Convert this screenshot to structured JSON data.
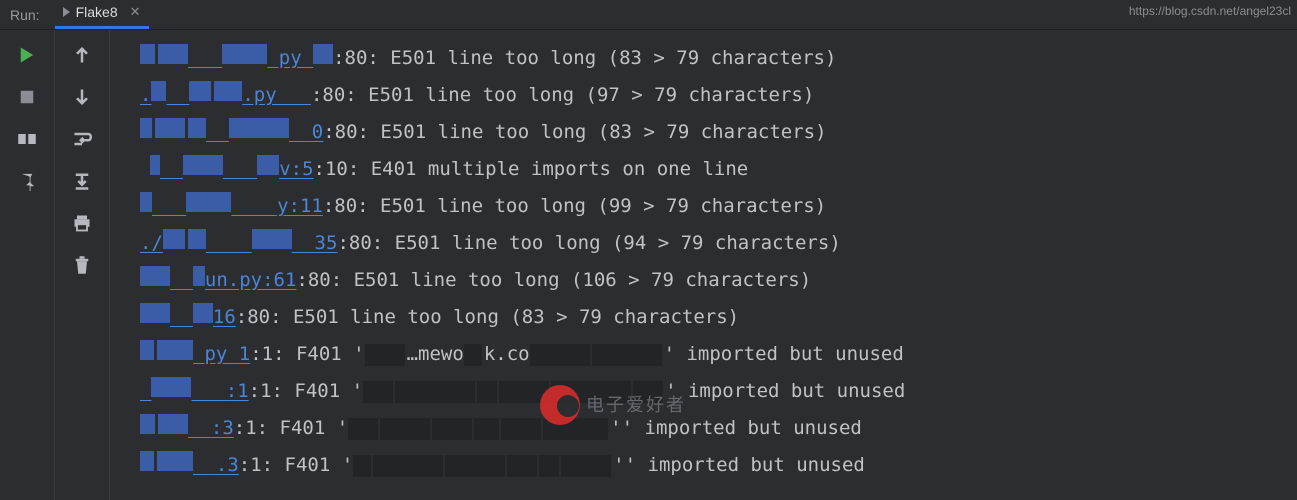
{
  "header": {
    "run_label": "Run:",
    "tab_name": "Flake8"
  },
  "watermark": "电子爱好者",
  "url_hint": "https://blog.csdn.net/angel23cl",
  "lines": [
    {
      "link_line": "",
      "link_col": "",
      "msg": ":80: E501 line too long (83 > 79 characters)"
    },
    {
      "link_line": "",
      "link_col": "",
      "msg": ":80: E501 line too long (97 > 79 characters)"
    },
    {
      "link_line": "",
      "link_col": "0",
      "msg": ":80: E501 line too long (83 > 79 characters)"
    },
    {
      "link_line": "v:5",
      "link_col": "",
      "msg": ":10: E401 multiple imports on one line"
    },
    {
      "link_line": "y:11",
      "link_col": "",
      "msg": ":80: E501 line too long (99 > 79 characters)"
    },
    {
      "link_line": "35",
      "link_col": "",
      "msg": ":80: E501 line too long (94 > 79 characters)"
    },
    {
      "link_line": "un.py:61",
      "link_col": "",
      "msg": ":80: E501 line too long (106 > 79 characters)"
    },
    {
      "link_line": "16",
      "link_col": "",
      "msg": ":80: E501 line too long (83 > 79 characters)"
    },
    {
      "link_line": "1",
      "link_col": "",
      "msg": ":1: F401 '",
      "tail": "' imported but unused"
    },
    {
      "link_line": ":1",
      "link_col": "",
      "msg": ":1: F401 '",
      "tail": "' imported but unused"
    },
    {
      "link_line": ":3",
      "link_col": "",
      "msg": ":1: F401 '",
      "tail": "' imported but unused"
    },
    {
      "link_line": ".3",
      "link_col": "",
      "msg": ":1: F401 '",
      "tail": "' imported but unused"
    }
  ]
}
